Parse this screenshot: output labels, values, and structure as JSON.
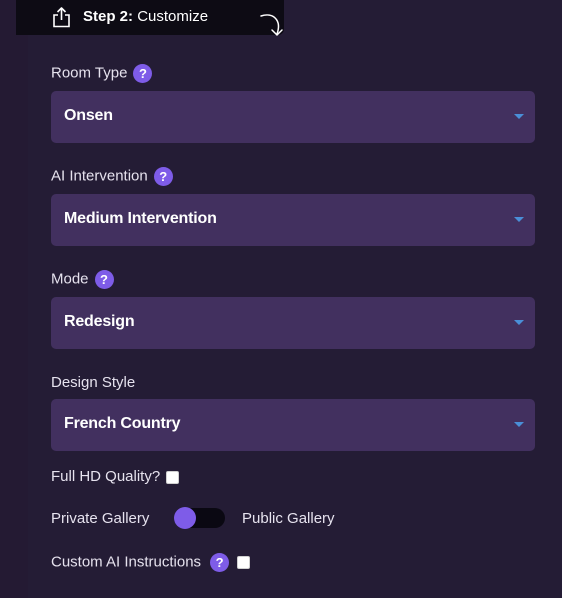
{
  "step": {
    "number_label": "Step 2:",
    "title": "Customize"
  },
  "fields": {
    "room_type": {
      "label": "Room Type",
      "help": "?",
      "value": "Onsen"
    },
    "ai_intervention": {
      "label": "AI Intervention",
      "help": "?",
      "value": "Medium Intervention"
    },
    "mode": {
      "label": "Mode",
      "help": "?",
      "value": "Redesign"
    },
    "design_style": {
      "label": "Design Style",
      "value": "French Country"
    }
  },
  "full_hd": {
    "label": "Full HD Quality?",
    "checked": false
  },
  "gallery_toggle": {
    "left_label": "Private Gallery",
    "right_label": "Public Gallery",
    "selected": "Private Gallery"
  },
  "custom_instructions": {
    "label": "Custom AI Instructions",
    "help": "?",
    "checked": false
  },
  "colors": {
    "accent": "#7e5ce8",
    "select_bg": "#42305f",
    "panel_bg": "#241c35",
    "header_bg": "#0d0b14",
    "caret": "#4a8fd8"
  }
}
